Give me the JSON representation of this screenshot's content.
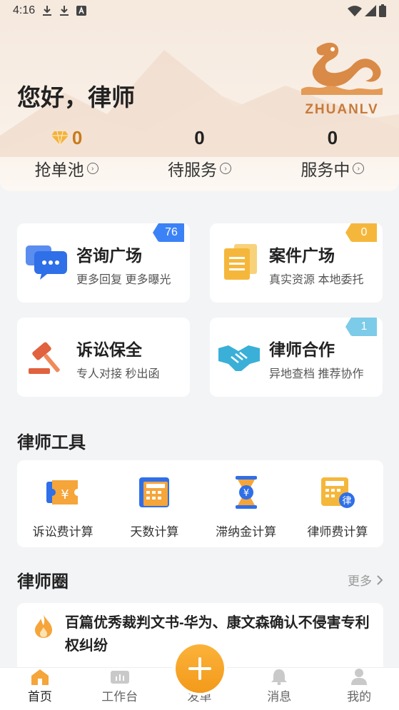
{
  "status_bar": {
    "time": "4:16",
    "icons": [
      "download-icon",
      "download-icon",
      "a-icon"
    ],
    "right_icons": [
      "wifi-icon",
      "signal-icon",
      "battery-icon"
    ]
  },
  "header": {
    "greeting": "您好，律师",
    "logo_text": "ZHUANLV"
  },
  "stats": [
    {
      "value": "0",
      "label": "抢单池",
      "icon": "diamond-icon"
    },
    {
      "value": "0",
      "label": "待服务"
    },
    {
      "value": "0",
      "label": "服务中"
    }
  ],
  "cards": [
    {
      "title": "咨询广场",
      "sub": "更多回复 更多曝光",
      "badge": "76",
      "badge_color": "#3b82f6",
      "icon": "chat-bubbles-icon"
    },
    {
      "title": "案件广场",
      "sub": "真实资源 本地委托",
      "badge": "0",
      "badge_color": "#f5b73b",
      "icon": "documents-icon"
    },
    {
      "title": "诉讼保全",
      "sub": "专人对接 秒出函",
      "badge": "",
      "icon": "gavel-icon"
    },
    {
      "title": "律师合作",
      "sub": "异地查档 推荐协作",
      "badge": "1",
      "badge_color": "#7ccbe8",
      "icon": "handshake-icon"
    }
  ],
  "tools_section": {
    "title": "律师工具",
    "items": [
      {
        "label": "诉讼费计算",
        "icon": "yen-ticket-icon"
      },
      {
        "label": "天数计算",
        "icon": "calendar-grid-icon"
      },
      {
        "label": "滞纳金计算",
        "icon": "hourglass-yen-icon"
      },
      {
        "label": "律师费计算",
        "icon": "calculator-lawyer-icon"
      }
    ]
  },
  "circle_section": {
    "title": "律师圈",
    "more": "更多",
    "post": {
      "title": "百篇优秀裁判文书-华为、康文森确认不侵害专利权纠纷",
      "icon": "flame-icon"
    }
  },
  "bottom_nav": [
    {
      "label": "首页",
      "icon": "home-icon",
      "active": true
    },
    {
      "label": "工作台",
      "icon": "dashboard-icon",
      "active": false
    },
    {
      "label": "发单",
      "icon": "plus-icon",
      "active": false
    },
    {
      "label": "消息",
      "icon": "bell-icon",
      "active": false
    },
    {
      "label": "我的",
      "icon": "user-icon",
      "active": false
    }
  ],
  "colors": {
    "accent": "#f39a1a",
    "badge_blue": "#3b82f6",
    "badge_gold": "#f5b73b",
    "badge_lightblue": "#7ccbe8",
    "brand": "#c87a3a"
  }
}
